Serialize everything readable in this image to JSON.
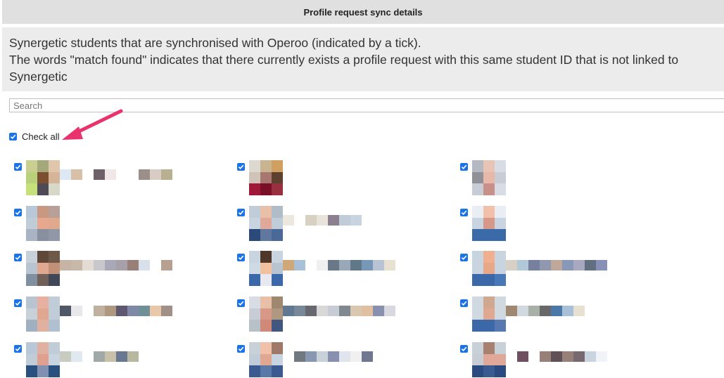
{
  "header": {
    "title": "Profile request sync details"
  },
  "description": {
    "line1": "Synergetic students that are synchronised with Operoo (indicated by a tick).",
    "line2": "The words \"match found\" indicates that there currently exists a profile request with this same student ID that is not linked to Synergetic"
  },
  "search": {
    "placeholder": "Search",
    "value": ""
  },
  "check_all": {
    "label": "Check all",
    "checked": true
  },
  "colors": {
    "checkbox": "#1a73e8",
    "arrow": "#e8336c",
    "header_bg": "#e0e0e0",
    "desc_bg": "#ececec"
  },
  "students": [
    {
      "checked": true,
      "thumb": [
        "#c9cf8f",
        "#a4a87a",
        "#e0c6aa",
        "#b9d17a",
        "#7a5030",
        "#d6b498",
        "#c6e07a",
        "#4e4a56",
        "#d8d8c8"
      ],
      "name": [
        "#dce8f4",
        "#d8c0a8",
        "#ffffff",
        "#6e6068",
        "#f0e8e8",
        "#ffffff",
        "#ffffff",
        "#9c8e88",
        "#d8ccc4",
        "#b8b090"
      ]
    },
    {
      "checked": true,
      "thumb": [
        "#ddd8d0",
        "#c8b490",
        "#d0a060",
        "#d0c4b8",
        "#a87870",
        "#5c4030",
        "#a01838",
        "#7a1028",
        "#983040"
      ],
      "name": []
    },
    {
      "checked": true,
      "thumb": [
        "#b4b8c0",
        "#e8c4b4",
        "#d8dce4",
        "#909098",
        "#e8b8a8",
        "#c8ccd4",
        "#c8ccd4",
        "#c89088",
        "#d8dce4"
      ],
      "name": []
    },
    {
      "checked": true,
      "thumb": [
        "#b8c8d8",
        "#c89880",
        "#b8a098",
        "#c0ccd8",
        "#e8a890",
        "#e0a88c",
        "#a8b4c4",
        "#8890a0",
        "#9098a8"
      ],
      "name": []
    },
    {
      "checked": true,
      "thumb": [
        "#c0ccd8",
        "#e8c0a8",
        "#b0bcc8",
        "#c8d4e0",
        "#e0a898",
        "#c0ccd8",
        "#2a4a7a",
        "#6078a0",
        "#4a6898"
      ],
      "name": [
        "#ece8e0",
        "#ffffff",
        "#d8d0c0",
        "#e8e4dc",
        "#8c8090",
        "#c0ccd8",
        "#c8d4e0"
      ]
    },
    {
      "checked": true,
      "thumb": [
        "#e8eef4",
        "#f0c0a8",
        "#e8eef4",
        "#c8d4e0",
        "#d89888",
        "#c8d4e0",
        "#3a6aa8",
        "#3a6aa8",
        "#3a6aa8"
      ],
      "name": []
    },
    {
      "checked": true,
      "thumb": [
        "#c8d0d8",
        "#604838",
        "#705848",
        "#b8c4d0",
        "#e0a890",
        "#c09078",
        "#8090a0",
        "#706058",
        "#404858"
      ],
      "name": [
        "#c8b4a4",
        "#c8b8a8",
        "#e4dcd4",
        "#c8c8cc",
        "#a8a8b8",
        "#a8a0a8",
        "#988078",
        "#d8e0ec",
        "#ffffff",
        "#b8a090"
      ]
    },
    {
      "checked": true,
      "thumb": [
        "#c8d4e0",
        "#503828",
        "#c8d4e0",
        "#d0dae4",
        "#f0c0a0",
        "#b8c4d0",
        "#3a68a8",
        "#e8e8f0",
        "#3a68a8"
      ],
      "name": [
        "#d0a878",
        "#a8c0d8",
        "#ffffff",
        "#f0f0f0",
        "#687888",
        "#98a8b8",
        "#607888",
        "#7898b8",
        "#b8c4d4",
        "#e8e0d0"
      ]
    },
    {
      "checked": true,
      "thumb": [
        "#c8d4e0",
        "#f0b090",
        "#c8d4e0",
        "#c8d4e0",
        "#e8a888",
        "#c8d4e0",
        "#3a68a8",
        "#3a68a8",
        "#4878b8"
      ],
      "name": [
        "#d8d0c4",
        "#b0c8d8",
        "#7880a0",
        "#9098b0",
        "#c0a898",
        "#8898b8",
        "#a8a8c0",
        "#607080",
        "#8890b8"
      ]
    },
    {
      "checked": true,
      "thumb": [
        "#b8c4d0",
        "#e8b0a0",
        "#c0ccd8",
        "#c8d0d8",
        "#e0a890",
        "#c0ccd8",
        "#a0b0c0",
        "#e0b0a0",
        "#b0c0d0"
      ],
      "name": [
        "#505868",
        "#e8e8ec",
        "#ffffff",
        "#c0b0a0",
        "#b09880",
        "#605870",
        "#8088a8",
        "#709098",
        "#e8c8a8",
        "#a09088"
      ]
    },
    {
      "checked": true,
      "thumb": [
        "#d8dce4",
        "#e8c0a8",
        "#a08870",
        "#c8ccd4",
        "#d89888",
        "#b09880",
        "#b8c0c8",
        "#d08878",
        "#405880"
      ],
      "name": [
        "#607890",
        "#788898",
        "#686870",
        "#d8d8d8",
        "#c8ccd4",
        "#808890",
        "#d8c8b0",
        "#e0c0a0",
        "#8890b0",
        "#d8d8e0"
      ]
    },
    {
      "checked": true,
      "thumb": [
        "#d0d8e0",
        "#d0a890",
        "#d0d8e0",
        "#d0d8e0",
        "#e0a890",
        "#d0d8e0",
        "#3a68a8",
        "#3a68a8",
        "#5878b0"
      ],
      "name": [
        "#a08870",
        "#d0d8e0",
        "#a8b0a8",
        "#686868",
        "#4a78a8",
        "#a8c0d8",
        "#e8e0d0",
        "#ffffff"
      ]
    },
    {
      "checked": true,
      "thumb": [
        "#b8c8d8",
        "#e0b0a0",
        "#c0ccd8",
        "#c0ccd8",
        "#e0a090",
        "#c8d4e0",
        "#2a5080",
        "#8090b0",
        "#2a5080"
      ],
      "name": [
        "#c8ccc0",
        "#e0e8f0",
        "#ffffff",
        "#a0a8a8",
        "#c8c0a8",
        "#687890",
        "#b8b8a0"
      ]
    },
    {
      "checked": true,
      "thumb": [
        "#c8d0d8",
        "#f0c0a8",
        "#a07868",
        "#c0ccd8",
        "#e0a890",
        "#c8d4e0",
        "#3a5a90",
        "#5878a8",
        "#3a5a90"
      ],
      "name": [
        "#ffffff",
        "#707880",
        "#8898b0",
        "#c8d0d8",
        "#8890b0",
        "#e0e4ec",
        "#f0f0f0",
        "#707890"
      ]
    },
    {
      "checked": true,
      "thumb": [
        "#c8d0d8",
        "#a88070",
        "#c8d0d8",
        "#c8ccd4",
        "#e0a898",
        "#e0a898",
        "#2a4a80",
        "#3a5a90",
        "#2a4a80"
      ],
      "name": [
        "#ffffff",
        "#705060",
        "#ffffff",
        "#988078",
        "#605058",
        "#988078",
        "#786870",
        "#c8d4e0",
        "#f0f4f8"
      ]
    }
  ]
}
